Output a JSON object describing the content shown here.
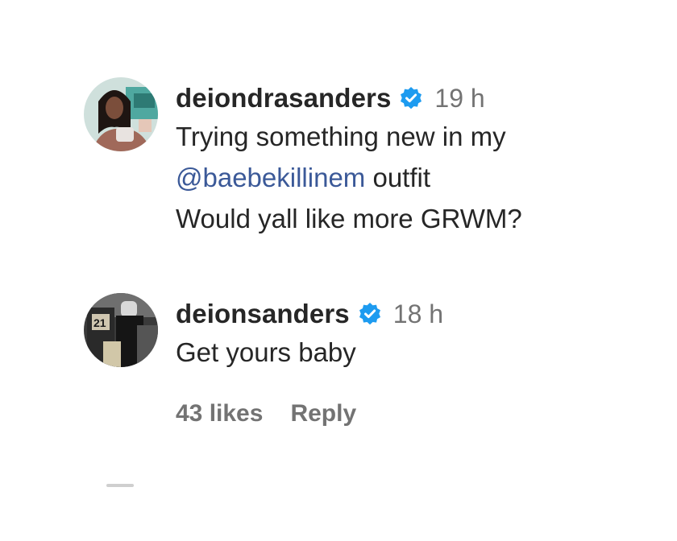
{
  "comments": [
    {
      "username": "deiondrasanders",
      "verified": true,
      "time": "19 h",
      "lines": {
        "line1": "Trying something new in my",
        "mention": "@baebekillinem",
        "line2_rest": " outfit",
        "line3": "Would yall like more GRWM?"
      }
    },
    {
      "username": "deionsanders",
      "verified": true,
      "time": "18 h",
      "text": "Get yours baby"
    }
  ],
  "actions": {
    "likes": "43 likes",
    "reply": "Reply"
  },
  "colors": {
    "verified_badge": "#1d9bf0",
    "mention": "#3b5998",
    "secondary_text": "#737373"
  }
}
